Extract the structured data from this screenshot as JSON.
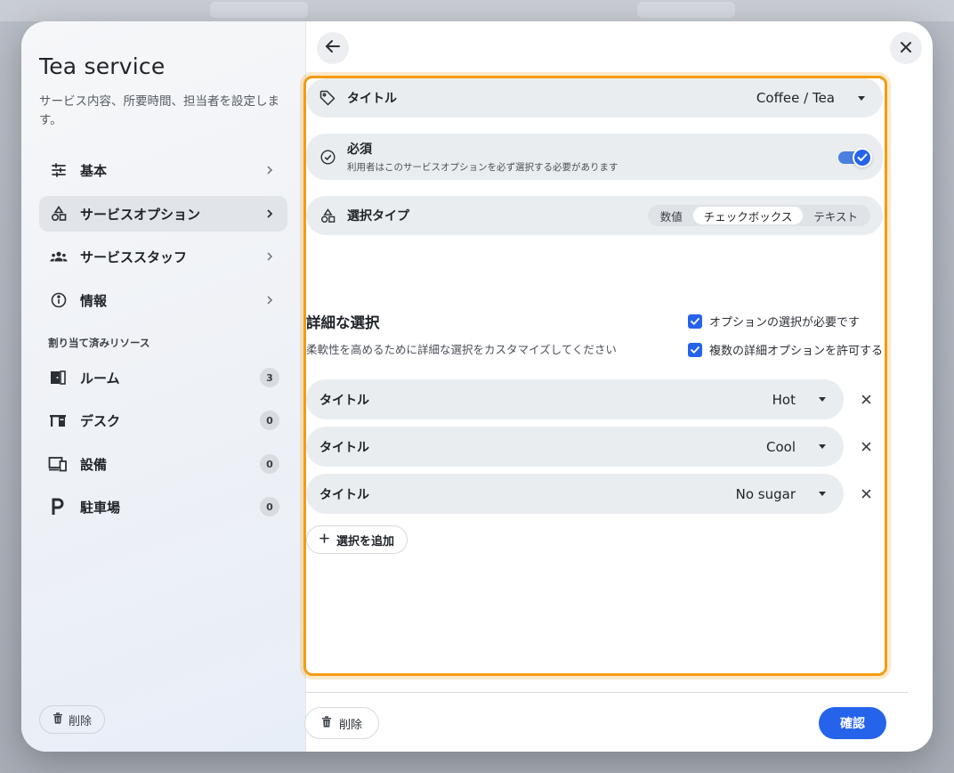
{
  "sidebar": {
    "title": "Tea service",
    "description": "サービス内容、所要時間、担当者を設定します。",
    "nav": [
      {
        "label": "基本",
        "icon": "sliders-icon"
      },
      {
        "label": "サービスオプション",
        "icon": "shapes-icon",
        "active": true
      },
      {
        "label": "サービススタッフ",
        "icon": "group-icon"
      },
      {
        "label": "情報",
        "icon": "info-icon"
      }
    ],
    "section_label": "割り当て済みリソース",
    "resources": [
      {
        "label": "ルーム",
        "count": "3",
        "icon": "room-door-icon"
      },
      {
        "label": "デスク",
        "count": "0",
        "icon": "desk-icon"
      },
      {
        "label": "設備",
        "count": "0",
        "icon": "devices-icon"
      },
      {
        "label": "駐車場",
        "count": "0",
        "icon": "parking-icon"
      }
    ],
    "delete_label": "削除"
  },
  "main": {
    "title_row": {
      "label": "タイトル",
      "value": "Coffee / Tea"
    },
    "required_row": {
      "label": "必須",
      "sublabel": "利用者はこのサービスオプションを必ず選択する必要があります",
      "enabled": true
    },
    "select_type_row": {
      "label": "選択タイプ",
      "options": [
        "数値",
        "チェックボックス",
        "テキスト"
      ],
      "selected": "チェックボックス"
    },
    "detail": {
      "title": "詳細な選択",
      "description": "柔軟性を高めるために詳細な選択をカスタマイズしてください",
      "checks": [
        "オプションの選択が必要です",
        "複数の詳細オプションを許可する"
      ]
    },
    "options": [
      {
        "label": "タイトル",
        "value": "Hot"
      },
      {
        "label": "タイトル",
        "value": "Cool"
      },
      {
        "label": "タイトル",
        "value": "No sugar"
      }
    ],
    "add_label": "選択を追加",
    "delete_label": "削除",
    "confirm_label": "確認"
  },
  "colors": {
    "accent": "#2563eb",
    "highlight": "#f39c12"
  }
}
